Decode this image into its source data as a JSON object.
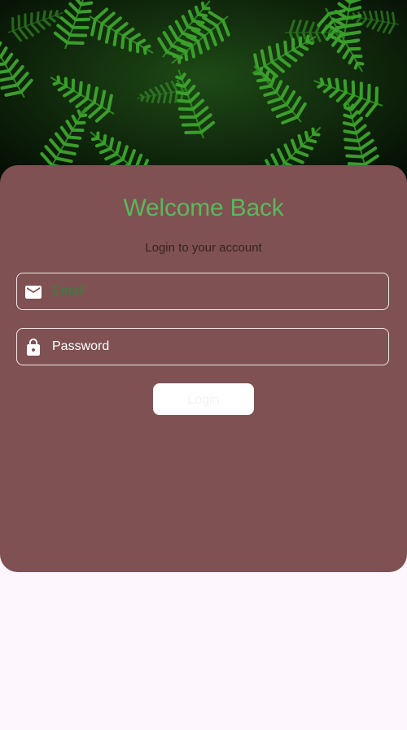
{
  "hero": {
    "image": "fern-leaves-background"
  },
  "card": {
    "title": "Welcome Back",
    "subtitle": "Login to your account",
    "email": {
      "icon": "mail-icon",
      "placeholder": "Email"
    },
    "password": {
      "icon": "lock-icon",
      "placeholder": "Password"
    },
    "login_label": "Login"
  },
  "colors": {
    "card_bg": "#7f5152",
    "title": "#5cb85c",
    "page_bg": "#fdf6fd",
    "button_bg": "#ffffff"
  }
}
